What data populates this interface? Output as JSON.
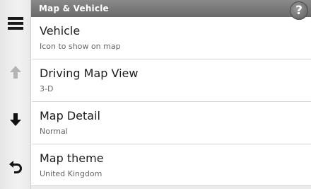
{
  "header": {
    "title": "Map & Vehicle",
    "help_label": "?"
  },
  "sidebar": {
    "buttons": [
      {
        "icon": "menu-icon",
        "enabled": true
      },
      {
        "icon": "arrow-up-icon",
        "enabled": false
      },
      {
        "icon": "arrow-down-icon",
        "enabled": true
      },
      {
        "icon": "back-icon",
        "enabled": true
      }
    ]
  },
  "settings": [
    {
      "title": "Vehicle",
      "value": "Icon to show on map"
    },
    {
      "title": "Driving Map View",
      "value": "3-D"
    },
    {
      "title": "Map Detail",
      "value": "Normal"
    },
    {
      "title": "Map theme",
      "value": "United Kingdom"
    }
  ],
  "colors": {
    "header_bg": "#7a7a7a",
    "text": "#1c1c1c",
    "subtext": "#666666",
    "disabled_icon": "#b4b4b4"
  }
}
